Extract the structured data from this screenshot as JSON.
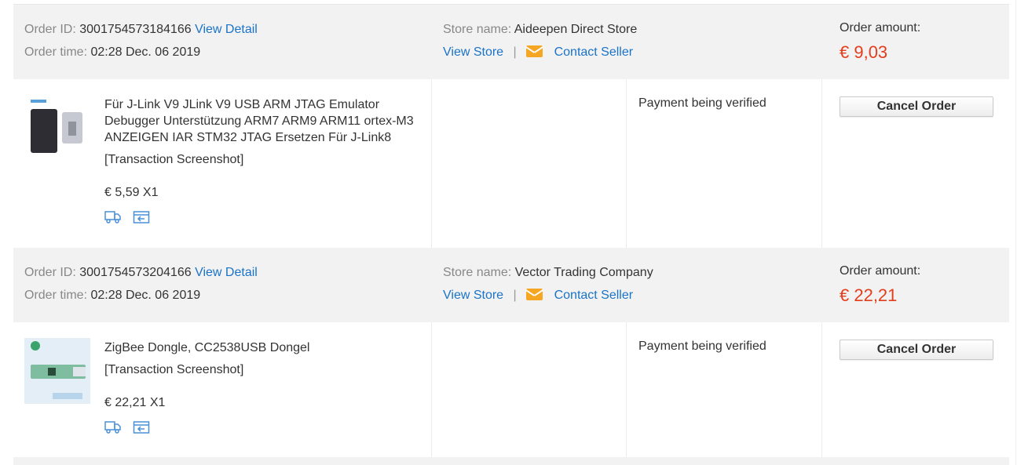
{
  "labels": {
    "order_id": "Order ID:",
    "order_time": "Order time:",
    "store_name": "Store name:",
    "view_detail": "View Detail",
    "view_store": "View Store",
    "separator": "|",
    "contact_seller": "Contact Seller",
    "order_amount": "Order amount:",
    "transaction_screenshot": "[Transaction Screenshot]",
    "cancel_order": "Cancel Order"
  },
  "orders": [
    {
      "id": "3001754573184166",
      "time": "02:28 Dec. 06 2019",
      "store": "Aideepen Direct Store",
      "amount": "€ 9,03",
      "product": {
        "title": "Für J-Link V9 JLink V9 USB ARM JTAG Emulator Debugger Unterstützung ARM7 ARM9 ARM11 ortex-M3 ANZEIGEN IAR STM32 JTAG Ersetzen Für J-Link8",
        "price_qty": "€ 5,59 X1"
      },
      "status": "Payment being verified"
    },
    {
      "id": "3001754573204166",
      "time": "02:28 Dec. 06 2019",
      "store": "Vector Trading Company",
      "amount": "€ 22,21",
      "product": {
        "title": "ZigBee Dongle, CC2538USB Dongel",
        "price_qty": "€ 22,21 X1"
      },
      "status": "Payment being verified"
    }
  ],
  "colors": {
    "link": "#1a73c7",
    "amount": "#e43d1c",
    "header_bg": "#f2f2f2",
    "mail_icon": "#f5a623"
  },
  "icons": [
    "mail-icon",
    "truck-icon",
    "return-icon"
  ]
}
